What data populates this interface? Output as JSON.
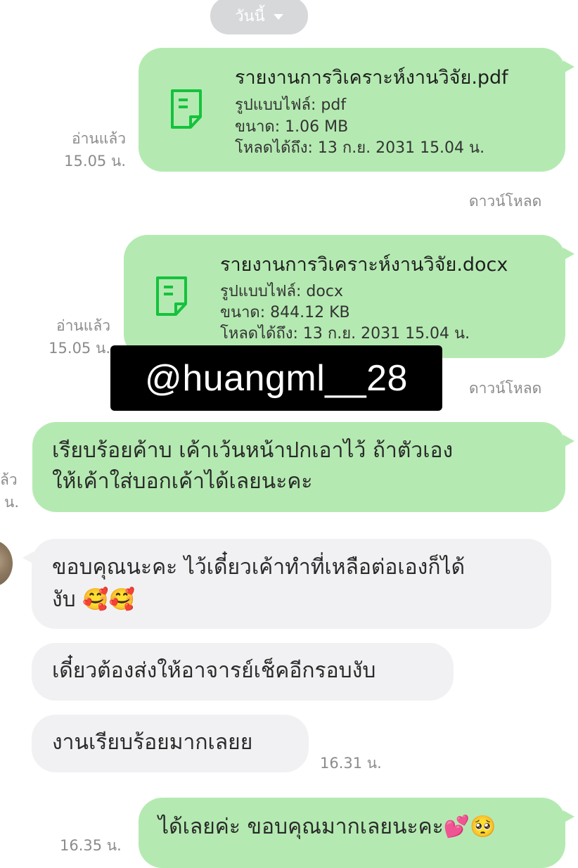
{
  "date_header": {
    "label": "วันนี้"
  },
  "files": [
    {
      "name": "รายงานการวิเคราะห์งานวิจัย.pdf",
      "type_line": "รูปแบบไฟล์: pdf",
      "size_line": "ขนาด: 1.06 MB",
      "expiry_line": "โหลดได้ถึง: 13 ก.ย. 2031 15.04 น.",
      "read_status": "อ่านแล้ว",
      "time": "15.05 น.",
      "download_label": "ดาวน์โหลด"
    },
    {
      "name": "รายงานการวิเคราะห์งานวิจัย.docx",
      "type_line": "รูปแบบไฟล์: docx",
      "size_line": "ขนาด: 844.12 KB",
      "expiry_line": "โหลดได้ถึง: 13 ก.ย. 2031 15.04 น.",
      "read_status": "อ่านแล้ว",
      "time": "15.05 น.",
      "download_label": "ดาวน์โหลด"
    }
  ],
  "watermark": "@huangml__28",
  "outgoing_1": {
    "line1": "เรียบร้อยค้าบ เค้าเว้นหน้าปกเอาไว้ ถ้าตัวเอง",
    "line2": "ให้เค้าใส่บอกเค้าได้เลยนะคะ",
    "read_status_partial": "ล้ว",
    "time_partial": "น."
  },
  "incoming": [
    {
      "line1": "ขอบคุณนะคะ ไว้เดี๋ยวเค้าทำที่เหลือต่อเองก็ได้",
      "line2": "งับ 🥰🥰"
    },
    {
      "line1": "เดี๋ยวต้องส่งให้อาจารย์เช็คอีกรอบงับ"
    },
    {
      "line1": "งานเรียบร้อยมากเลยย",
      "time": "16.31 น."
    }
  ],
  "outgoing_2": {
    "text": "ได้เลยค่ะ ขอบคุณมากเลยนะคะ💕🥺",
    "time_partial": "16.35 น."
  },
  "colors": {
    "outgoing_bubble": "#b4eab1",
    "incoming_bubble": "#f1f1f3",
    "file_icon": "#15c23d",
    "meta_text": "#8b8b8b"
  },
  "icons": {
    "file": "document-icon",
    "date_toggle": "chevron-down-icon"
  }
}
